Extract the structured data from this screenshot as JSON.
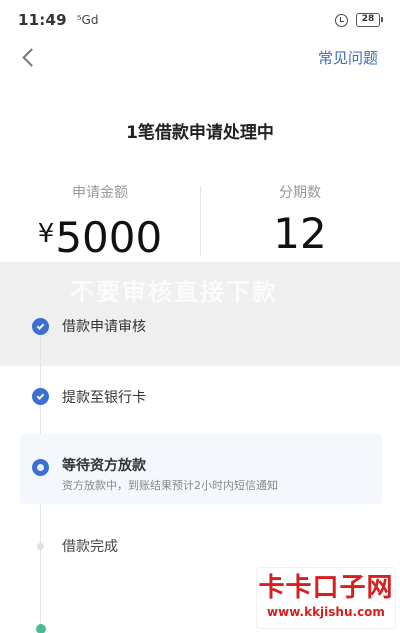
{
  "status_bar": {
    "time": "11:49",
    "signal": "⁵Gd",
    "battery": "28"
  },
  "nav": {
    "faq_label": "常见问题"
  },
  "title": "1笔借款申请处理中",
  "summary": {
    "amount_label": "申请金额",
    "currency": "¥",
    "amount_value": "5000",
    "periods_label": "分期数",
    "periods_value": "12"
  },
  "watermark": {
    "text": "不要审核直接下款"
  },
  "timeline": {
    "steps": [
      {
        "label": "借款申请审核",
        "desc": "",
        "state": "done"
      },
      {
        "label": "提款至银行卡",
        "desc": "",
        "state": "done"
      },
      {
        "label": "等待资方放款",
        "desc": "资方放款中，到账结果预计2小时内短信通知",
        "state": "current"
      },
      {
        "label": "借款完成",
        "desc": "",
        "state": "pending"
      }
    ]
  },
  "site_logo": {
    "title": "卡卡口子网",
    "url": "www.kkjishu.com"
  },
  "colors": {
    "accent": "#3b6fd4",
    "link": "#3d6fb8",
    "logo_red": "#d81e1e"
  }
}
